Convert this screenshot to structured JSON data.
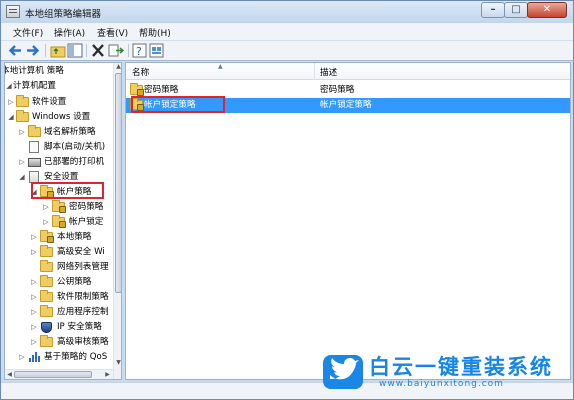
{
  "window": {
    "title": "本地组策略编辑器",
    "buttons": {
      "minimize": "–",
      "maximize": "□",
      "close": "✕"
    }
  },
  "menu": [
    {
      "label": "文件(F)"
    },
    {
      "label": "操作(A)"
    },
    {
      "label": "查看(V)"
    },
    {
      "label": "帮助(H)"
    }
  ],
  "toolbar": {
    "icons": [
      "back-arrow-icon",
      "forward-arrow-icon",
      "up-folder-icon",
      "show-hide-tree-icon",
      "delete-icon",
      "export-icon",
      "help-icon",
      "properties-icon"
    ]
  },
  "tree": {
    "root": "本地计算机 策略",
    "items": [
      {
        "label": "计算机配置"
      },
      {
        "label": "软件设置"
      },
      {
        "label": "Windows 设置"
      },
      {
        "label": "域名解析策略"
      },
      {
        "label": "脚本(启动/关机)"
      },
      {
        "label": "已部署的打印机"
      },
      {
        "label": "安全设置"
      },
      {
        "label": "帐户策略"
      },
      {
        "label": "密码策略"
      },
      {
        "label": "帐户锁定"
      },
      {
        "label": "本地策略"
      },
      {
        "label": "高级安全 Wi"
      },
      {
        "label": "网络列表管理"
      },
      {
        "label": "公钥策略"
      },
      {
        "label": "软件限制策略"
      },
      {
        "label": "应用程序控制"
      },
      {
        "label": "IP 安全策略"
      },
      {
        "label": "高级审核策略"
      },
      {
        "label": "基于策略的 QoS"
      }
    ]
  },
  "list": {
    "columns": {
      "name": "名称",
      "description": "描述"
    },
    "rows": [
      {
        "name": "密码策略",
        "description": "密码策略"
      },
      {
        "name": "帐户锁定策略",
        "description": "帐户锁定策略"
      }
    ]
  },
  "watermark": {
    "text": "白云一键重装系统",
    "url": "www.baiyunxitong.com"
  },
  "colors": {
    "selection": "#3399ff",
    "highlight_box": "#e0242b",
    "watermark": "#1685e8"
  }
}
